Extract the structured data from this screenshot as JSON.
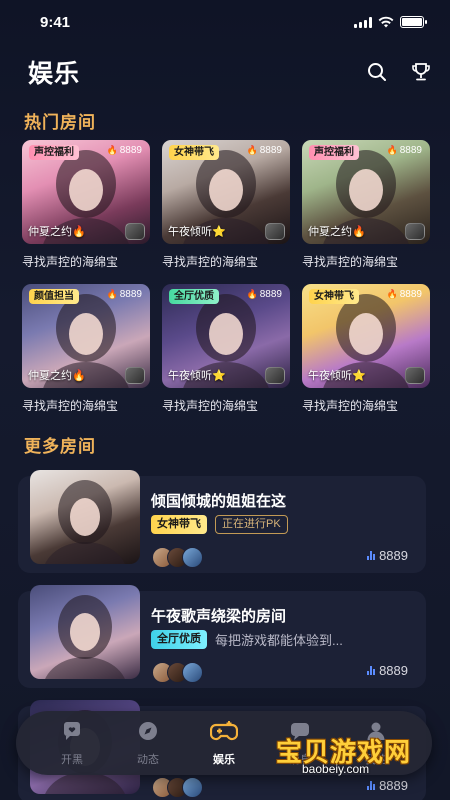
{
  "status_bar": {
    "time": "9:41"
  },
  "header": {
    "title": "娱乐"
  },
  "hot_section": {
    "title": "热门房间",
    "cards": [
      {
        "tag": "声控福利",
        "tag_color": "pink",
        "heat": "8889",
        "host": "仲夏之约",
        "badge": "🔥",
        "name": "寻找声控的海绵宝",
        "bg": "linear-gradient(160deg,#f7c6d6 0%,#e38fb3 35%,#7a3b5b 70%,#2b1a2a 100%)"
      },
      {
        "tag": "女神带飞",
        "tag_color": "gold",
        "heat": "8889",
        "host": "午夜倾听",
        "badge": "⭐",
        "name": "寻找声控的海绵宝",
        "bg": "linear-gradient(160deg,#d9d4d2 0%,#b8aaa3 35%,#4a3a36 65%,#1b1416 100%)"
      },
      {
        "tag": "声控福利",
        "tag_color": "pink",
        "heat": "8889",
        "host": "仲夏之约",
        "badge": "🔥",
        "name": "寻找声控的海绵宝",
        "bg": "linear-gradient(160deg,#c9d8b8 0%,#9fb58a 35%,#5d5140 65%,#2a221c 100%)"
      },
      {
        "tag": "颜值担当",
        "tag_color": "gold",
        "heat": "8889",
        "host": "仲夏之约",
        "badge": "🔥",
        "name": "寻找声控的海绵宝",
        "bg": "linear-gradient(160deg,#4a4d7a 0%,#7a7ab0 35%,#caa7b8 65%,#3a2c44 100%)"
      },
      {
        "tag": "全厅优质",
        "tag_color": "green",
        "heat": "8889",
        "host": "午夜倾听",
        "badge": "⭐",
        "name": "寻找声控的海绵宝",
        "bg": "linear-gradient(160deg,#2c2a52 0%,#5a4a8a 40%,#8a6aa8 65%,#2a2040 100%)"
      },
      {
        "tag": "女神带飞",
        "tag_color": "gold",
        "heat": "8889",
        "host": "午夜倾听",
        "badge": "⭐",
        "name": "寻找声控的海绵宝",
        "bg": "linear-gradient(160deg,#f7e08a 0%,#f2c56a 35%,#b87ac8 65%,#4a2a5a 100%)"
      }
    ]
  },
  "more_section": {
    "title": "更多房间",
    "rooms": [
      {
        "title": "倾国倾城的姐姐在这",
        "tag": "女神带飞",
        "tag_color": "gold",
        "extra": "正在进行PK",
        "extra_kind": "pk",
        "count": "8889",
        "bg": "linear-gradient(160deg,#e8e4e2 0%,#cbb9b0 35%,#4a3a36 65%,#1b1416 100%)"
      },
      {
        "title": "午夜歌声绕梁的房间",
        "tag": "全厅优质",
        "tag_color": "blue",
        "extra": "每把游戏都能体验到...",
        "extra_kind": "desc",
        "count": "8889",
        "bg": "linear-gradient(160deg,#4a4d7a 0%,#7a7ab0 35%,#caa7b8 65%,#3a2c44 100%)"
      },
      {
        "title": "",
        "tag": "",
        "tag_color": "gold",
        "extra": "",
        "extra_kind": "desc",
        "count": "8889",
        "bg": "linear-gradient(160deg,#2c2a52 0%,#5a4a8a 40%,#8a6aa8 65%,#2a2040 100%)"
      }
    ]
  },
  "tabbar": {
    "tabs": [
      {
        "label": "开黑",
        "icon": "heart-chat-icon",
        "active": false
      },
      {
        "label": "动态",
        "icon": "compass-icon",
        "active": false
      },
      {
        "label": "娱乐",
        "icon": "gamepad-icon",
        "active": true
      },
      {
        "label": "消息",
        "icon": "message-icon",
        "active": false
      },
      {
        "label": "我的",
        "icon": "user-icon",
        "active": false
      }
    ]
  },
  "watermark": {
    "text": "宝贝游戏网",
    "url": "baobeiy.com"
  },
  "colors": {
    "accent_gold": "#f0b35a",
    "card_bg": "#1c2136",
    "bar_blue": "#5b8cff"
  }
}
